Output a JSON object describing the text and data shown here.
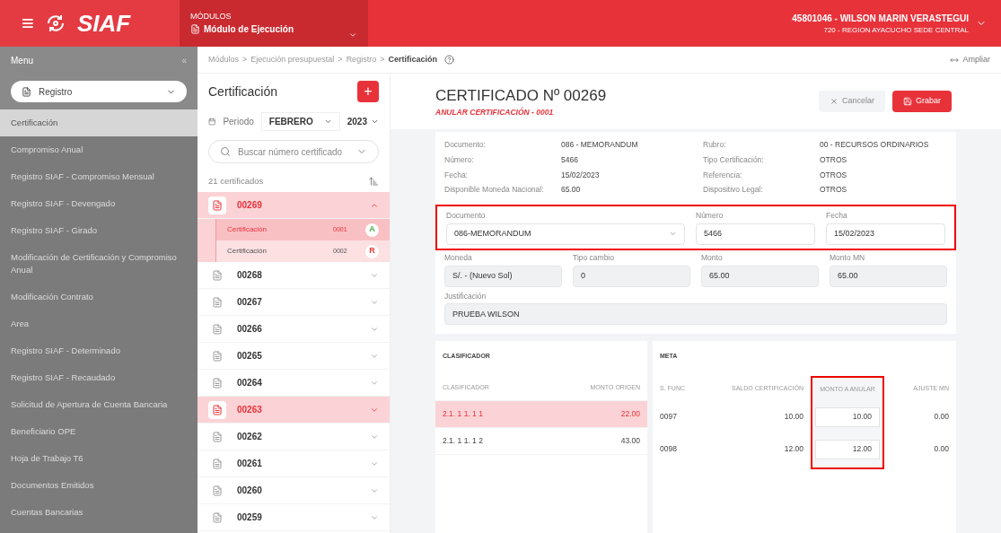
{
  "header": {
    "menu_icon": "≡",
    "logo": "SIAF",
    "modules_label": "MÓDULOS",
    "module": "Módulo de Ejecución",
    "user": "45801046 - WILSON MARIN VERASTEGUI",
    "unit": "720 - REGION AYACUCHO SEDE CENTRAL"
  },
  "sidebar": {
    "title": "Menu",
    "collapse": "«",
    "dropdown": "Registro",
    "items": [
      {
        "label": "Certificación",
        "selected": true
      },
      {
        "label": "Compromiso Anual",
        "selected": false
      },
      {
        "label": "Registro SIAF - Compromiso Mensual",
        "selected": false
      },
      {
        "label": "Registro SIAF - Devengado",
        "selected": false
      },
      {
        "label": "Registro SIAF - Girado",
        "selected": false
      },
      {
        "label": "Modificación de Certificación y Compromiso Anual",
        "selected": false
      },
      {
        "label": "Modificación Contrato",
        "selected": false
      },
      {
        "label": "Area",
        "selected": false
      },
      {
        "label": "Registro SIAF - Determinado",
        "selected": false
      },
      {
        "label": "Registro SIAF - Recaudado",
        "selected": false
      },
      {
        "label": "Solicitud de Apertura de Cuenta Bancaria",
        "selected": false
      },
      {
        "label": "Beneficiario OPE",
        "selected": false
      },
      {
        "label": "Hoja de Trabajo T6",
        "selected": false
      },
      {
        "label": "Documentos Emitidos",
        "selected": false
      },
      {
        "label": "Cuentas Bancarias",
        "selected": false
      }
    ]
  },
  "breadcrumb_separator": ">",
  "breadcrumb": [
    "Módulos",
    "Ejecución presupuestal",
    "Registro",
    "Certificación"
  ],
  "expand_link": "Ampliar",
  "list": {
    "title": "Certificación",
    "add": "+",
    "period_label": "Periodo",
    "month": "FEBRERO",
    "year": "2023",
    "search_placeholder": "Buscar número certificado",
    "count": "21 certificados",
    "items": [
      {
        "number": "00269",
        "selected": true,
        "expanded": true,
        "children": [
          {
            "label": "Certificación",
            "code": "0001",
            "status": "A",
            "color": "#4caf50",
            "selected": true
          },
          {
            "label": "Certificación",
            "code": "0002",
            "status": "R",
            "color": "#e53935",
            "selected": false
          }
        ]
      },
      {
        "number": "00268",
        "selected": false,
        "expanded": false
      },
      {
        "number": "00267",
        "selected": false,
        "expanded": false
      },
      {
        "number": "00266",
        "selected": false,
        "expanded": false
      },
      {
        "number": "00265",
        "selected": false,
        "expanded": false
      },
      {
        "number": "00264",
        "selected": false,
        "expanded": false
      },
      {
        "number": "00263",
        "selected": true,
        "expanded": false
      },
      {
        "number": "00262",
        "selected": false,
        "expanded": false
      },
      {
        "number": "00261",
        "selected": false,
        "expanded": false
      },
      {
        "number": "00260",
        "selected": false,
        "expanded": false
      },
      {
        "number": "00259",
        "selected": false,
        "expanded": false
      }
    ]
  },
  "detail": {
    "title": "CERTIFICADO Nº 00269",
    "subtitle": "ANULAR CERTIFICACIÓN - 0001",
    "cancel": "Cancelar",
    "save": "Grabar",
    "info_left": [
      {
        "label": "Documento:",
        "value": "086 - MEMORANDUM"
      },
      {
        "label": "Número:",
        "value": "5466"
      },
      {
        "label": "Fecha:",
        "value": "15/02/2023"
      },
      {
        "label": "Disponible Moneda Nacional:",
        "value": "65.00"
      }
    ],
    "info_right": [
      {
        "label": "Rubro:",
        "value": "00 - RECURSOS ORDINARIOS"
      },
      {
        "label": "Tipo Certificación:",
        "value": "OTROS"
      },
      {
        "label": "Referencia:",
        "value": "OTROS"
      },
      {
        "label": "Dispositivo Legal:",
        "value": "OTROS"
      }
    ],
    "document": {
      "label": "Documento",
      "value": "086-MEMORANDUM"
    },
    "number": {
      "label": "Número",
      "value": "5466"
    },
    "date": {
      "label": "Fecha",
      "value": "15/02/2023"
    },
    "readonly": [
      {
        "label": "Moneda",
        "value": "S/. - (Nuevo Sol)"
      },
      {
        "label": "Tipo cambio",
        "value": "0"
      },
      {
        "label": "Monto",
        "value": "65.00"
      },
      {
        "label": "Monto MN",
        "value": "65.00"
      }
    ],
    "justification": {
      "label": "Justificación",
      "value": "PRUEBA WILSON"
    }
  },
  "clasificador": {
    "title": "CLASIFICADOR",
    "columns": [
      "CLASIFICADOR",
      "MONTO ORIGEN"
    ],
    "rows": [
      {
        "cells": [
          "2.1. 1 1. 1 1",
          "22.00"
        ],
        "selected": true
      },
      {
        "cells": [
          "2.1. 1 1. 1 2",
          "43.00"
        ],
        "selected": false
      }
    ]
  },
  "meta": {
    "title": "META",
    "columns": [
      "S. FUNC",
      "SALDO CERTIFICACIÓN",
      "MONTO A ANULAR",
      "AJUSTE MN"
    ],
    "rows": [
      {
        "func": "0097",
        "saldo": "10.00",
        "anular": "10.00",
        "ajuste": "0.00"
      },
      {
        "func": "0098",
        "saldo": "12.00",
        "anular": "12.00",
        "ajuste": "0.00"
      }
    ]
  }
}
